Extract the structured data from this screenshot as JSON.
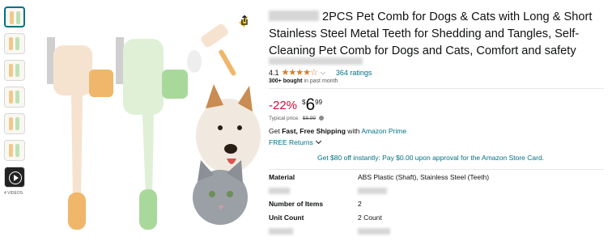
{
  "thumbnails": [
    "image-1",
    "image-2",
    "image-3",
    "image-4",
    "image-5",
    "image-6",
    "video"
  ],
  "videos_label": "4 VIDEOS",
  "product": {
    "title": "2PCS Pet Comb for Dogs & Cats with Long & Short Stainless Steel Metal Teeth for Shedding and Tangles, Self-Cleaning Pet Comb for Dogs and Cats, Comfort and safety",
    "rating_value": "4.1",
    "stars": "★★★★☆",
    "ratings_count": "364 ratings",
    "bought_bold": "300+ bought",
    "bought_rest": " in past month"
  },
  "price": {
    "discount": "-22%",
    "currency": "$",
    "whole": "6",
    "fraction": "99",
    "typical_label": "Typical price:",
    "typical_value": "$8.99"
  },
  "shipping": {
    "prefix": "Get ",
    "bold": "Fast, Free Shipping",
    "middle": " with ",
    "link": "Amazon Prime"
  },
  "returns_label": "FREE Returns",
  "card_offer": "Get $80 off instantly: Pay $0.00 upon approval for the Amazon Store Card.",
  "specs": [
    {
      "key": "Material",
      "value": "ABS Plastic (Shaft), Stainless Steel (Teeth)"
    },
    {
      "key": "",
      "value": ""
    },
    {
      "key": "Number of Items",
      "value": "2"
    },
    {
      "key": "Unit Count",
      "value": "2 Count"
    },
    {
      "key": "",
      "value": ""
    }
  ],
  "colors": {
    "link": "#007185",
    "discount": "#cc0c39",
    "star": "#de7921",
    "comb_orange": "#f0b66a",
    "comb_green": "#a9d89b"
  }
}
